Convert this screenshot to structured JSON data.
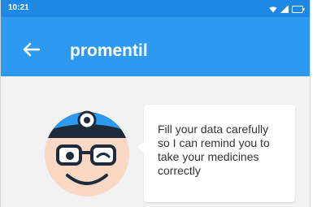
{
  "status_bar": {
    "time": "10:21",
    "icons": [
      "wifi-icon",
      "signal-icon",
      "battery-icon"
    ]
  },
  "app_bar": {
    "title": "promentil",
    "back_icon": "arrow-left-icon"
  },
  "main": {
    "mascot": "doctor-mascot-illustration",
    "message": "Fill your data carefully\nso I can remind you to\ntake your medicines\ncorrectly"
  },
  "colors": {
    "status_bar": "#1e88e5",
    "app_bar": "#2d9af0",
    "background": "#f2f2f2",
    "bubble": "#ffffff",
    "mascot_skin": "#fbd8c4"
  }
}
